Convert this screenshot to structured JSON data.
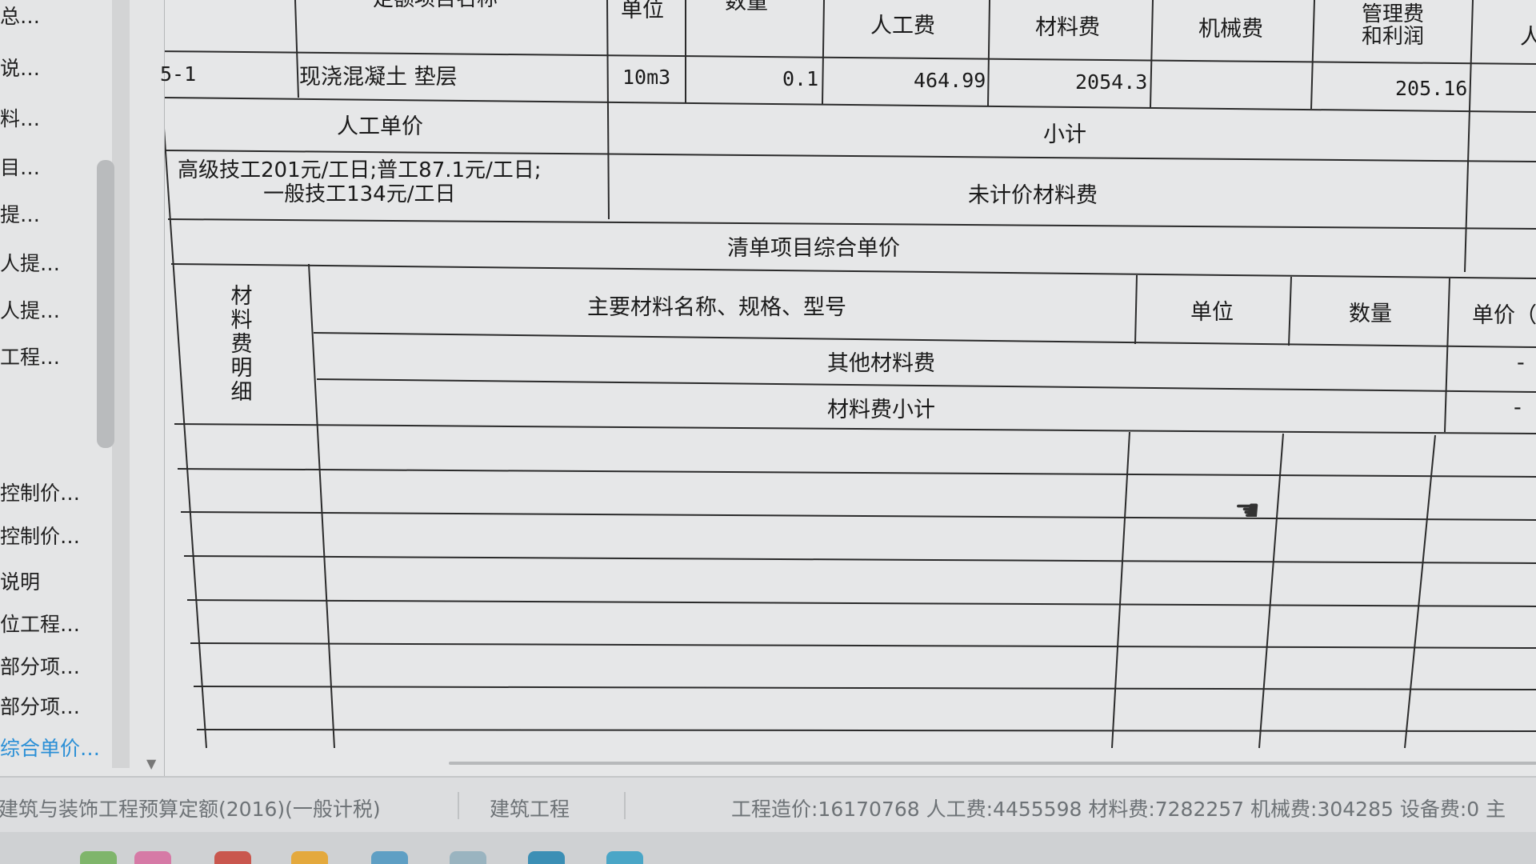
{
  "sidebar": {
    "items": [
      {
        "label": "总…"
      },
      {
        "label": "说…"
      },
      {
        "label": "料…"
      },
      {
        "label": "目…"
      },
      {
        "label": "提…"
      },
      {
        "label": "人提…"
      },
      {
        "label": "人提…"
      },
      {
        "label": "工程…"
      },
      {
        "label": "控制价…"
      },
      {
        "label": "控制价…"
      },
      {
        "label": "说明"
      },
      {
        "label": "位工程…"
      },
      {
        "label": "部分项…"
      },
      {
        "label": "部分项…"
      },
      {
        "label": "综合单价…"
      }
    ]
  },
  "sheet": {
    "header": {
      "name": "定额项目名称",
      "unit": "单位",
      "qty": "数量",
      "labor": "人工费",
      "material": "材料费",
      "machine": "机械费",
      "mgmt_line1": "管理费",
      "mgmt_line2": "和利润",
      "edge": "人"
    },
    "row": {
      "code": "5-1",
      "name": "现浇混凝土 垫层",
      "unit": "10m3",
      "qty": "0.1",
      "labor": "464.99",
      "material": "2054.3",
      "machine": "",
      "mgmt": "205.16"
    },
    "labor_unit_price_label": "人工单价",
    "labor_rates_line1": "高级技工201元/工日;普工87.1元/工日;",
    "labor_rates_line2": "一般技工134元/工日",
    "subtotal_label": "小计",
    "unpriced_label": "未计价材料费",
    "composite_price_label": "清单项目综合单价",
    "material_detail_label": "材料费明细",
    "material_headers": {
      "name": "主要材料名称、规格、型号",
      "unit": "单位",
      "qty": "数量",
      "price": "单价（"
    },
    "other_material_label": "其他材料费",
    "other_material_value": "-",
    "material_subtotal_label": "材料费小计",
    "material_subtotal_value": "-"
  },
  "statusbar": {
    "quota": "建筑与装饰工程预算定额(2016)(一般计税)",
    "project_type": "建筑工程",
    "summary": "工程造价:16170768  人工费:4455598  材料费:7282257  机械费:304285  设备费:0  主"
  },
  "colors": {
    "background": "#e6e7e8",
    "grid_line": "#2b2b2b",
    "active_nav": "#2a8fd6",
    "status_text": "#6d7276"
  }
}
